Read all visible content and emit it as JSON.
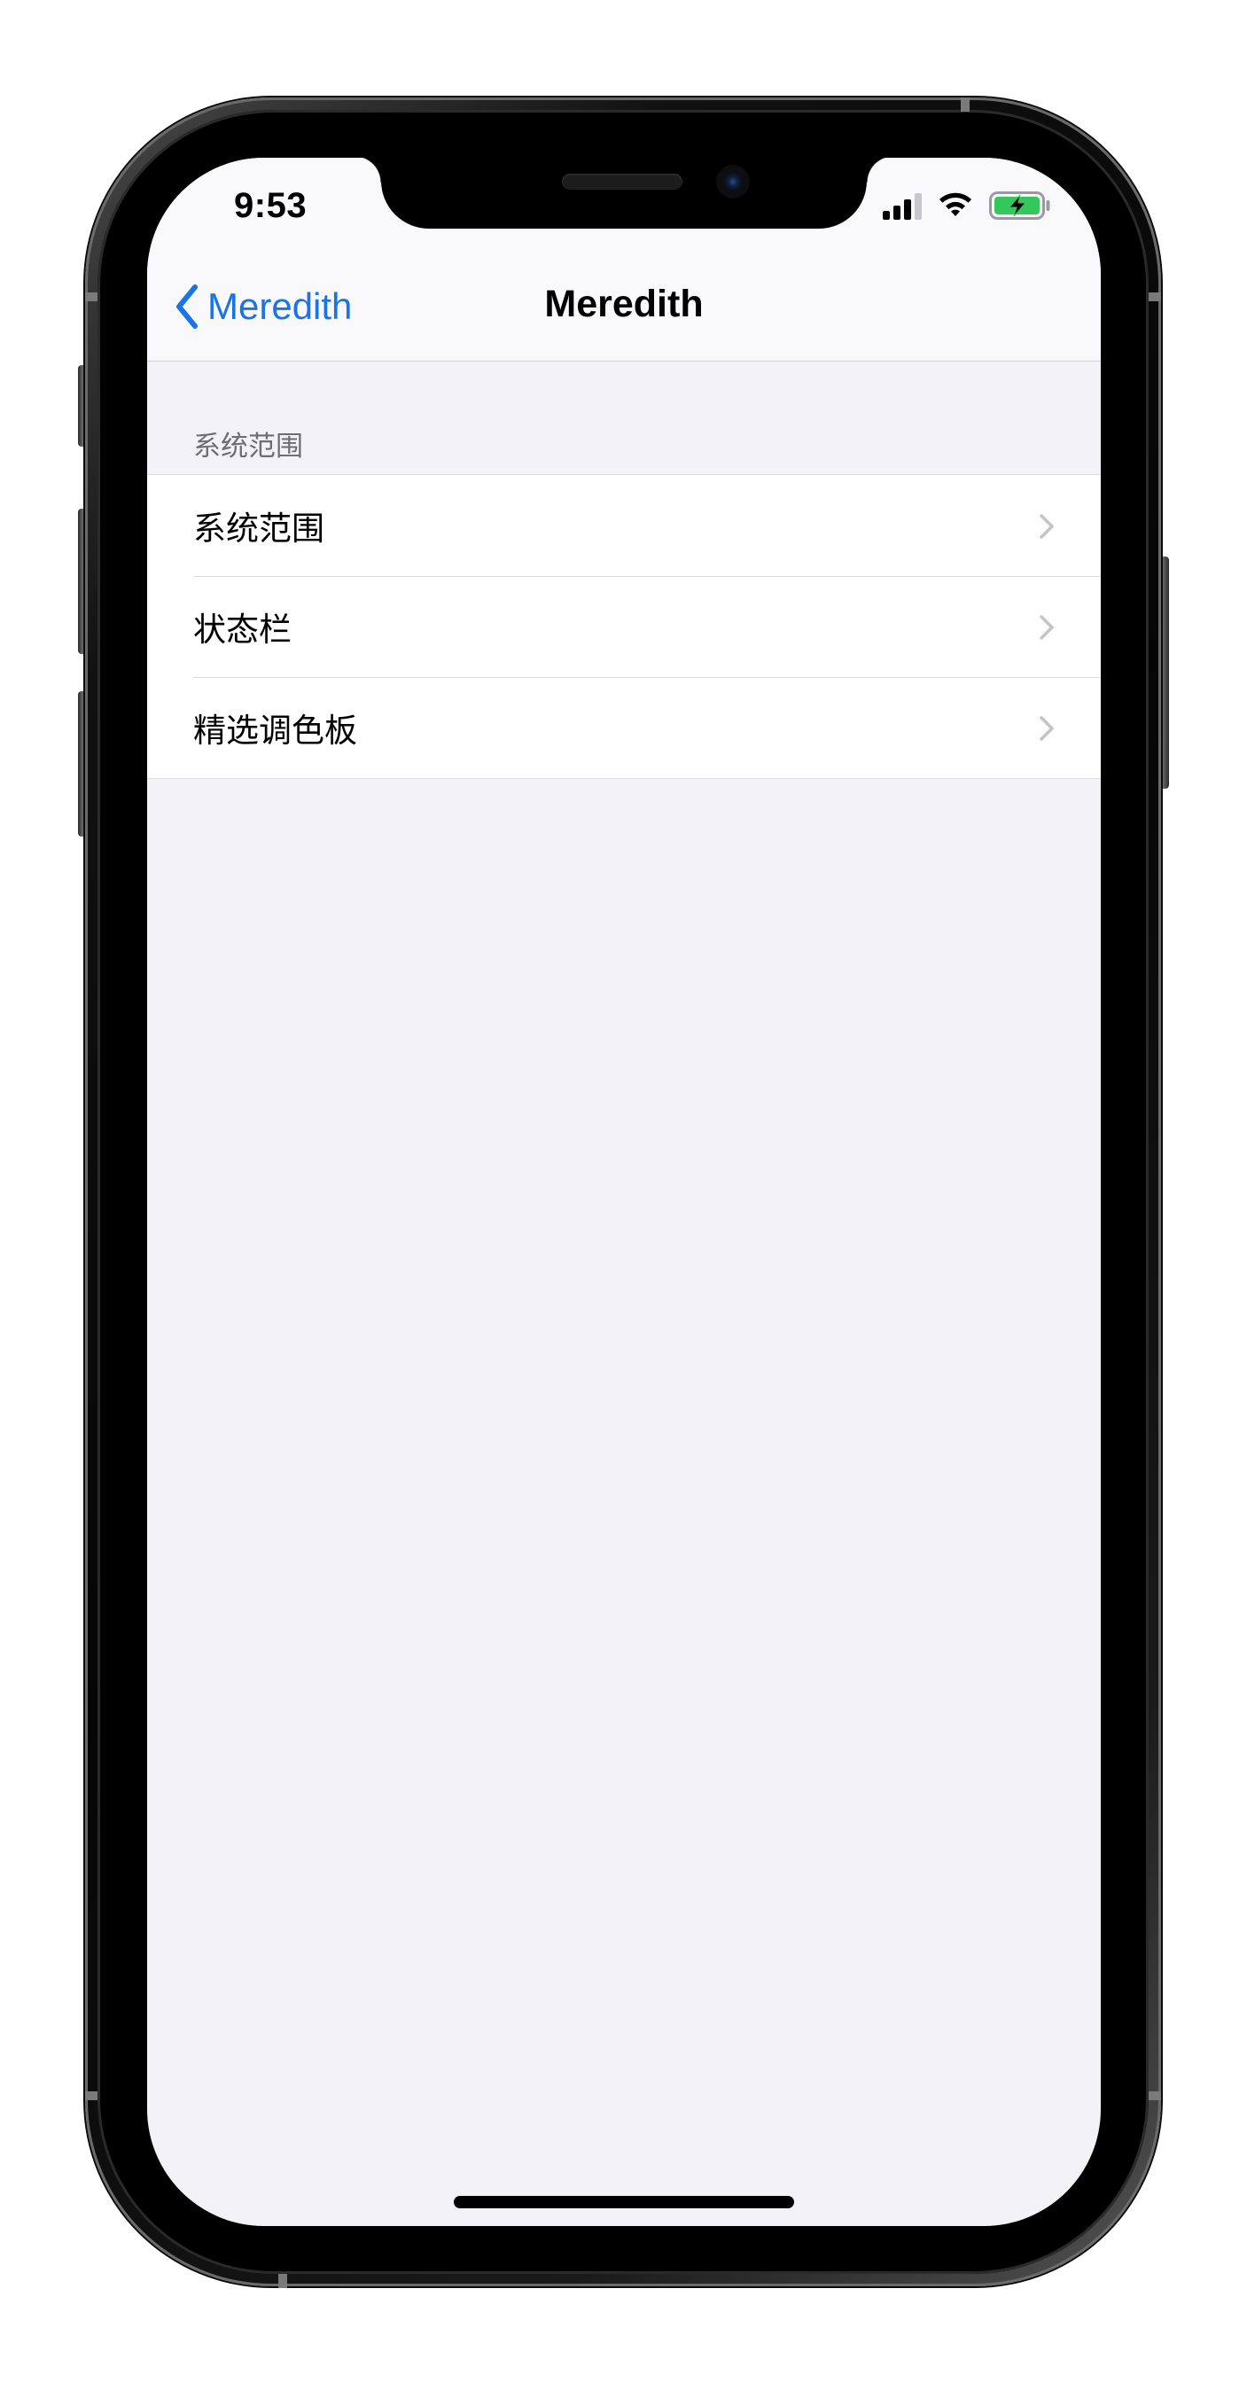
{
  "status_bar": {
    "time": "9:53"
  },
  "nav": {
    "back_label": "Meredith",
    "title": "Meredith"
  },
  "section": {
    "header": "系统范围",
    "items": [
      {
        "label": "系统范围"
      },
      {
        "label": "状态栏"
      },
      {
        "label": "精选调色板"
      }
    ]
  },
  "colors": {
    "accent": "#1a73e8",
    "battery_fill": "#34c759",
    "background": "#f2f2f7"
  },
  "icons": {
    "back": "chevron-left-icon",
    "row_disclosure": "chevron-right-icon",
    "signal": "cellular-signal-icon",
    "wifi": "wifi-icon",
    "battery": "battery-charging-icon"
  }
}
